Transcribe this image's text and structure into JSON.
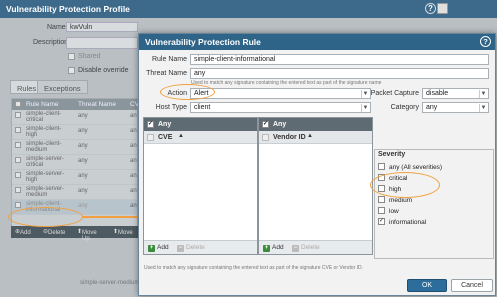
{
  "profile": {
    "title": "Vulnerability Protection Profile",
    "name_label": "Name",
    "name_value": "kwVuln",
    "description_label": "Description",
    "shared_label": "Shared",
    "disable_override_label": "Disable override",
    "tabs": [
      "Rules",
      "Exceptions"
    ],
    "columns": [
      "Rule Name",
      "Threat Name",
      "CV"
    ],
    "rows": [
      {
        "name": "simple-client-critical",
        "threat": "any",
        "cv": "an"
      },
      {
        "name": "simple-client-high",
        "threat": "any",
        "cv": "an"
      },
      {
        "name": "simple-client-medium",
        "threat": "any",
        "cv": "an"
      },
      {
        "name": "simple-server-critical",
        "threat": "any",
        "cv": "an"
      },
      {
        "name": "simple-server-high",
        "threat": "any",
        "cv": "an"
      },
      {
        "name": "simple-server-medium",
        "threat": "any",
        "cv": "an"
      },
      {
        "name": "simple-client-informational",
        "threat": "any",
        "cv": "an"
      }
    ],
    "footer": [
      "Add",
      "Delete",
      "Move Up",
      "Move"
    ],
    "behind_text": "simple-server-medium"
  },
  "dialog": {
    "title": "Vulnerability Protection Rule",
    "rule_name_label": "Rule Name",
    "rule_name_value": "simple-client-informational",
    "threat_name_label": "Threat Name",
    "threat_name_value": "any",
    "threat_hint": "Used to match any signature containing the entered text as part of the signature name",
    "action_label": "Action",
    "action_value": "Alert",
    "packet_capture_label": "Packet Capture",
    "packet_capture_value": "disable",
    "host_type_label": "Host Type",
    "host_type_value": "client",
    "category_label": "Category",
    "category_value": "any",
    "cve_grid": {
      "any_label": "Any",
      "column": "CVE",
      "add": "Add",
      "delete": "Delete"
    },
    "vendor_grid": {
      "any_label": "Any",
      "column": "Vendor ID",
      "add": "Add",
      "delete": "Delete"
    },
    "severity": {
      "title": "Severity",
      "items": [
        {
          "label": "any (All severities)",
          "checked": false
        },
        {
          "label": "critical",
          "checked": false
        },
        {
          "label": "high",
          "checked": false
        },
        {
          "label": "medium",
          "checked": false
        },
        {
          "label": "low",
          "checked": false
        },
        {
          "label": "informational",
          "checked": true
        }
      ]
    },
    "bottom_hint": "Used to match any signature containing the entered text as part of the signature CVE or Vendor ID.",
    "ok_label": "OK",
    "cancel_label": "Cancel"
  },
  "colors": {
    "highlight": "#f0a040",
    "title_bar": "#2f6489",
    "ok_button": "#2d6d9b"
  }
}
